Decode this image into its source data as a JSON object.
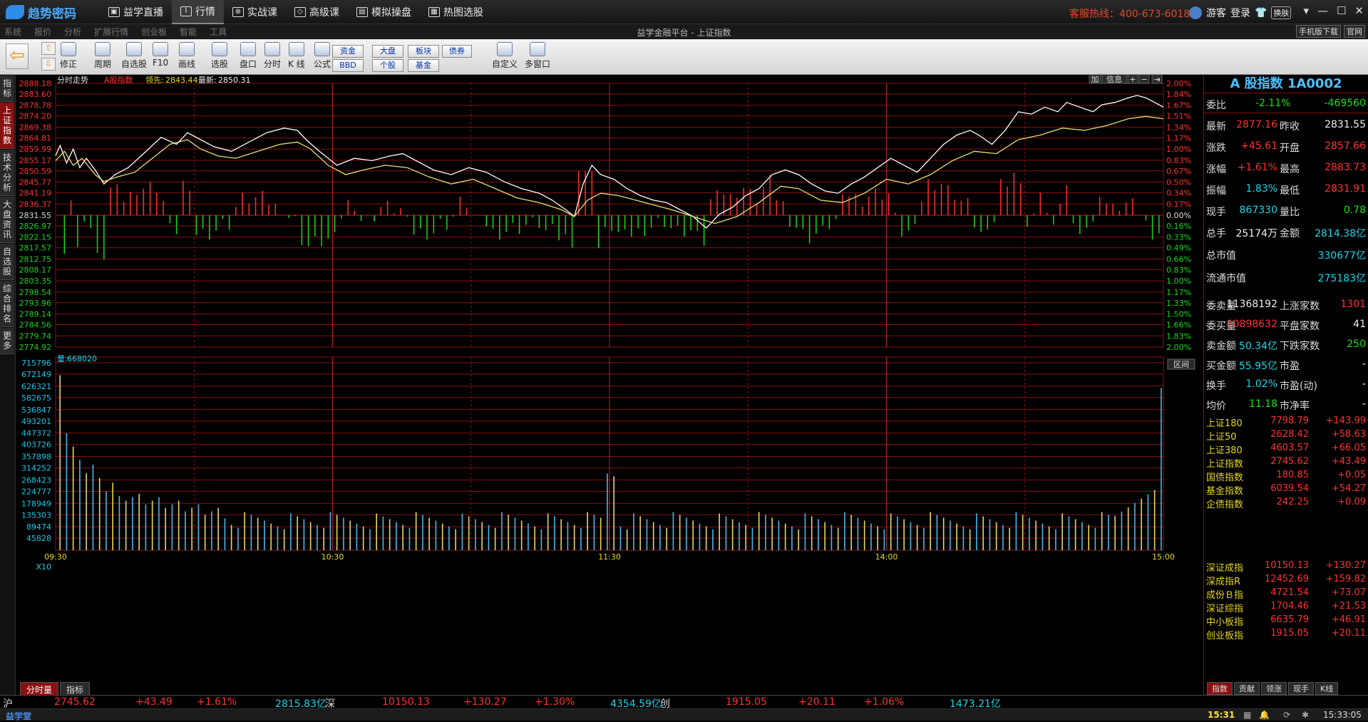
{
  "app": {
    "brand": "趋势密码",
    "nav": [
      {
        "label": "益学直播",
        "icon": "tv-icon"
      },
      {
        "label": "行情",
        "icon": "chart-icon",
        "active": true
      },
      {
        "label": "实战课",
        "icon": "target-icon"
      },
      {
        "label": "高级课",
        "icon": "diamond-icon"
      },
      {
        "label": "模拟操盘",
        "icon": "monitor-icon"
      },
      {
        "label": "热图选股",
        "icon": "grid-icon"
      }
    ],
    "hotline": "客服热线：400-673-6018",
    "user": "游客",
    "login": "登录",
    "skin": "换肤",
    "window_controls": [
      "▾",
      "—",
      "☐",
      "✕"
    ]
  },
  "menubar": {
    "items": [
      "系统",
      "报价",
      "分析",
      "扩展行情",
      "创业板",
      "智能",
      "工具"
    ],
    "window_title": "益学金融平台 - 上证指数",
    "links": [
      "手机版下载",
      "官网"
    ]
  },
  "toolbar": {
    "buttons": [
      "修正",
      "周期",
      "自选股",
      "F10",
      "画线",
      "选股",
      "盘口",
      "分时",
      "K 线",
      "公式",
      "自定义",
      "多窗口"
    ],
    "small_buttons": [
      "资金",
      "BBD",
      "大盘",
      "个股",
      "板块",
      "基金",
      "债券"
    ]
  },
  "side_tabs": [
    "指标",
    "上证指数",
    "技术分析",
    "大盘资讯",
    "自选股",
    "综合排名",
    "更多"
  ],
  "chart": {
    "header": {
      "title": "分时走势",
      "name": "A股指数",
      "lead_label": "领先:",
      "lead": "2843.44",
      "latest_label": "最新:",
      "latest": "2850.31"
    },
    "top_right_buttons": [
      "加",
      "信息",
      "+",
      "−",
      "⇥"
    ],
    "vol_label": "量:",
    "vol_value": "668020",
    "range_button": "区间",
    "x10": "X10",
    "bottom_tabs": [
      "分时量",
      "指标"
    ]
  },
  "chart_data": {
    "type": "line",
    "prev_close": 2831.55,
    "price_axis_ticks": [
      "2888.18",
      "2883.60",
      "2878.78",
      "2874.20",
      "2869.38",
      "2864.81",
      "2859.99",
      "2855.17",
      "2850.59",
      "2845.77",
      "2841.19",
      "2836.37",
      "2831.55",
      "2826.97",
      "2822.15",
      "2817.57",
      "2812.75",
      "2808.17",
      "2803.35",
      "2798.54",
      "2793.96",
      "2789.14",
      "2784.56",
      "2779.74",
      "2774.92"
    ],
    "pct_axis_ticks": [
      "2.00%",
      "1.84%",
      "1.67%",
      "1.51%",
      "1.34%",
      "1.17%",
      "1.00%",
      "0.83%",
      "0.67%",
      "0.50%",
      "0.34%",
      "0.17%",
      "0.00%",
      "0.16%",
      "0.33%",
      "0.49%",
      "0.66%",
      "0.83%",
      "1.00%",
      "1.17%",
      "1.33%",
      "1.50%",
      "1.66%",
      "1.83%",
      "2.00%"
    ],
    "volume_axis_ticks": [
      "715796",
      "672149",
      "626321",
      "582675",
      "536847",
      "493201",
      "447372",
      "403726",
      "357898",
      "314252",
      "268423",
      "224777",
      "178949",
      "135303",
      "89474",
      "45828"
    ],
    "time_labels": [
      "09:30",
      "10:30",
      "11:30",
      "14:00",
      "15:00"
    ],
    "series": [
      {
        "name": "",
        "color": "#ffffff",
        "points": [
          [
            0,
            2857.1
          ],
          [
            2,
            2861.5
          ],
          [
            5,
            2854
          ],
          [
            8,
            2860
          ],
          [
            11,
            2852
          ],
          [
            14,
            2856
          ],
          [
            18,
            2851
          ],
          [
            22,
            2845
          ],
          [
            27,
            2849
          ],
          [
            33,
            2852
          ],
          [
            40,
            2858
          ],
          [
            48,
            2865
          ],
          [
            55,
            2862
          ],
          [
            60,
            2867
          ],
          [
            66,
            2864
          ],
          [
            72,
            2861
          ],
          [
            80,
            2859
          ],
          [
            88,
            2863
          ],
          [
            96,
            2867
          ],
          [
            104,
            2869
          ],
          [
            110,
            2868
          ],
          [
            114,
            2864
          ],
          [
            120,
            2859
          ],
          [
            128,
            2853
          ],
          [
            136,
            2856
          ],
          [
            144,
            2855
          ],
          [
            152,
            2857
          ],
          [
            158,
            2858
          ],
          [
            164,
            2855
          ],
          [
            172,
            2851
          ],
          [
            180,
            2849
          ],
          [
            188,
            2852
          ],
          [
            196,
            2850
          ],
          [
            204,
            2846
          ],
          [
            212,
            2843
          ],
          [
            220,
            2841
          ],
          [
            226,
            2838
          ],
          [
            232,
            2834
          ],
          [
            236,
            2831
          ],
          [
            240,
            2845
          ],
          [
            244,
            2853
          ],
          [
            248,
            2849
          ],
          [
            254,
            2847
          ],
          [
            260,
            2843
          ],
          [
            266,
            2840
          ],
          [
            272,
            2838
          ],
          [
            278,
            2837
          ],
          [
            284,
            2834
          ],
          [
            290,
            2831
          ],
          [
            296,
            2826
          ],
          [
            302,
            2832
          ],
          [
            308,
            2835
          ],
          [
            314,
            2840
          ],
          [
            320,
            2843
          ],
          [
            326,
            2849
          ],
          [
            332,
            2851
          ],
          [
            338,
            2849
          ],
          [
            344,
            2845
          ],
          [
            350,
            2842
          ],
          [
            356,
            2841
          ],
          [
            362,
            2845
          ],
          [
            368,
            2848
          ],
          [
            374,
            2852
          ],
          [
            380,
            2856
          ],
          [
            386,
            2853
          ],
          [
            392,
            2850
          ],
          [
            398,
            2856
          ],
          [
            404,
            2862
          ],
          [
            410,
            2866
          ],
          [
            416,
            2868
          ],
          [
            420,
            2866
          ],
          [
            426,
            2862
          ],
          [
            432,
            2868
          ],
          [
            438,
            2876
          ],
          [
            444,
            2875
          ],
          [
            450,
            2878
          ],
          [
            456,
            2876
          ],
          [
            460,
            2880
          ],
          [
            466,
            2878
          ],
          [
            472,
            2876
          ],
          [
            476,
            2879
          ],
          [
            482,
            2880
          ],
          [
            488,
            2882
          ],
          [
            492,
            2883
          ],
          [
            496,
            2882
          ],
          [
            500,
            2880
          ],
          [
            504,
            2878
          ]
        ]
      },
      {
        "name": "",
        "color": "#e8e070",
        "points": [
          [
            0,
            2855
          ],
          [
            4,
            2859
          ],
          [
            8,
            2853
          ],
          [
            12,
            2856
          ],
          [
            18,
            2849
          ],
          [
            22,
            2846
          ],
          [
            28,
            2848
          ],
          [
            36,
            2850
          ],
          [
            44,
            2856
          ],
          [
            52,
            2862
          ],
          [
            60,
            2864
          ],
          [
            66,
            2860
          ],
          [
            74,
            2857
          ],
          [
            82,
            2856
          ],
          [
            92,
            2859
          ],
          [
            102,
            2862
          ],
          [
            110,
            2863
          ],
          [
            116,
            2860
          ],
          [
            124,
            2853
          ],
          [
            132,
            2849
          ],
          [
            140,
            2851
          ],
          [
            150,
            2853
          ],
          [
            160,
            2852
          ],
          [
            170,
            2848
          ],
          [
            180,
            2845
          ],
          [
            190,
            2847
          ],
          [
            200,
            2843
          ],
          [
            210,
            2839
          ],
          [
            220,
            2837
          ],
          [
            230,
            2834
          ],
          [
            236,
            2831
          ],
          [
            242,
            2838
          ],
          [
            248,
            2841
          ],
          [
            256,
            2840
          ],
          [
            264,
            2838
          ],
          [
            272,
            2836
          ],
          [
            280,
            2834
          ],
          [
            290,
            2831
          ],
          [
            300,
            2828
          ],
          [
            310,
            2831
          ],
          [
            320,
            2837
          ],
          [
            330,
            2844
          ],
          [
            338,
            2843
          ],
          [
            348,
            2838
          ],
          [
            358,
            2837
          ],
          [
            368,
            2841
          ],
          [
            378,
            2847
          ],
          [
            388,
            2845
          ],
          [
            398,
            2849
          ],
          [
            408,
            2855
          ],
          [
            418,
            2859
          ],
          [
            428,
            2858
          ],
          [
            438,
            2864
          ],
          [
            448,
            2866
          ],
          [
            458,
            2869
          ],
          [
            468,
            2868
          ],
          [
            478,
            2870
          ],
          [
            488,
            2873
          ],
          [
            496,
            2874
          ],
          [
            504,
            2873
          ]
        ]
      }
    ],
    "price_bars_note": "red bars above zero line, green below",
    "colors": {
      "grid": "#8a1010",
      "up": "#ff3030",
      "down": "#18d818",
      "vol_a": "#4ab8e8",
      "vol_b": "#e8d860"
    }
  },
  "panel": {
    "title": "A 股指数 1A0002",
    "weibi": {
      "label": "委比",
      "pct": "-2.11%",
      "val": "-469560"
    },
    "rows": [
      {
        "l1": "最新",
        "v1": "2877.16",
        "c1": "red",
        "l2": "昨收",
        "v2": "2831.55",
        "c2": "wht"
      },
      {
        "l1": "涨跌",
        "v1": "+45.61",
        "c1": "red",
        "l2": "开盘",
        "v2": "2857.66",
        "c2": "red"
      },
      {
        "l1": "涨幅",
        "v1": "+1.61%",
        "c1": "red",
        "l2": "最高",
        "v2": "2883.73",
        "c2": "red"
      },
      {
        "l1": "振幅",
        "v1": "1.83%",
        "c1": "cyan",
        "l2": "最低",
        "v2": "2831.91",
        "c2": "red"
      },
      {
        "l1": "现手",
        "v1": "867330",
        "c1": "cyan",
        "l2": "量比",
        "v2": "0.78",
        "c2": "green"
      },
      {
        "l1": "总手",
        "v1": "25174万",
        "c1": "wht",
        "l2": "金额",
        "v2": "2814.38亿",
        "c2": "cyan"
      }
    ],
    "mkt": [
      {
        "l": "总市值",
        "v": "330677亿"
      },
      {
        "l": "流通市值",
        "v": "275183亿"
      }
    ],
    "flow": [
      {
        "l1": "委卖量",
        "v1": "11368192",
        "c1": "wht",
        "l2": "上涨家数",
        "v2": "1301",
        "c2": "red"
      },
      {
        "l1": "委买量",
        "v1": "10898632",
        "c1": "red",
        "l2": "平盘家数",
        "v2": "41",
        "c2": "wht"
      },
      {
        "l1": "卖金额",
        "v1": "50.34亿",
        "c1": "cyan",
        "l2": "下跌家数",
        "v2": "250",
        "c2": "green"
      },
      {
        "l1": "买金额",
        "v1": "55.95亿",
        "c1": "cyan",
        "l2": "市盈",
        "v2": "-",
        "c2": "wht"
      },
      {
        "l1": "换手",
        "v1": "1.02%",
        "c1": "cyan",
        "l2": "市盈(动)",
        "v2": "-",
        "c2": "wht"
      },
      {
        "l1": "均价",
        "v1": "11.18",
        "c1": "green",
        "l2": "市净率",
        "v2": "-",
        "c2": "wht"
      }
    ],
    "indices_sh": [
      {
        "n": "上证180",
        "p": "7798.79",
        "c": "+143.99"
      },
      {
        "n": "上证50",
        "p": "2628.42",
        "c": "+58.63"
      },
      {
        "n": "上证380",
        "p": "4603.57",
        "c": "+66.05"
      },
      {
        "n": "上证指数",
        "p": "2745.62",
        "c": "+43.49"
      },
      {
        "n": "国债指数",
        "p": "180.85",
        "c": "+0.05"
      },
      {
        "n": "基金指数",
        "p": "6039.54",
        "c": "+54.27"
      },
      {
        "n": "企债指数",
        "p": "242.25",
        "c": "+0.09"
      }
    ],
    "indices_sz": [
      {
        "n": "深证成指",
        "p": "10150.13",
        "c": "+130.27"
      },
      {
        "n": "深成指R",
        "p": "12452.69",
        "c": "+159.82"
      },
      {
        "n": "成份Ｂ指",
        "p": "4721.54",
        "c": "+73.07"
      },
      {
        "n": "深证综指",
        "p": "1704.46",
        "c": "+21.53"
      },
      {
        "n": "中小板指",
        "p": "6635.79",
        "c": "+46.91"
      },
      {
        "n": "创业板指",
        "p": "1915.05",
        "c": "+20.11"
      }
    ],
    "bottom_tabs": [
      "指数",
      "贡献",
      "领涨",
      "现手",
      "K线"
    ]
  },
  "ticker": {
    "sh_label": "沪",
    "sh_price": "2745.62",
    "sh_chg": "+43.49",
    "sh_pct": "+1.61%",
    "sh_amt": "2815.83亿",
    "sz_label": "深",
    "sz_price": "10150.13",
    "sz_chg": "+130.27",
    "sz_pct": "+1.30%",
    "sz_amt": "4354.59亿",
    "cy_label": "创",
    "cy_price": "1915.05",
    "cy_chg": "+20.11",
    "cy_pct": "+1.06%",
    "cy_amt": "1473.21亿"
  },
  "status": {
    "brand": "益学堂",
    "clock1": "15:31",
    "clock2": "15:33:05"
  }
}
